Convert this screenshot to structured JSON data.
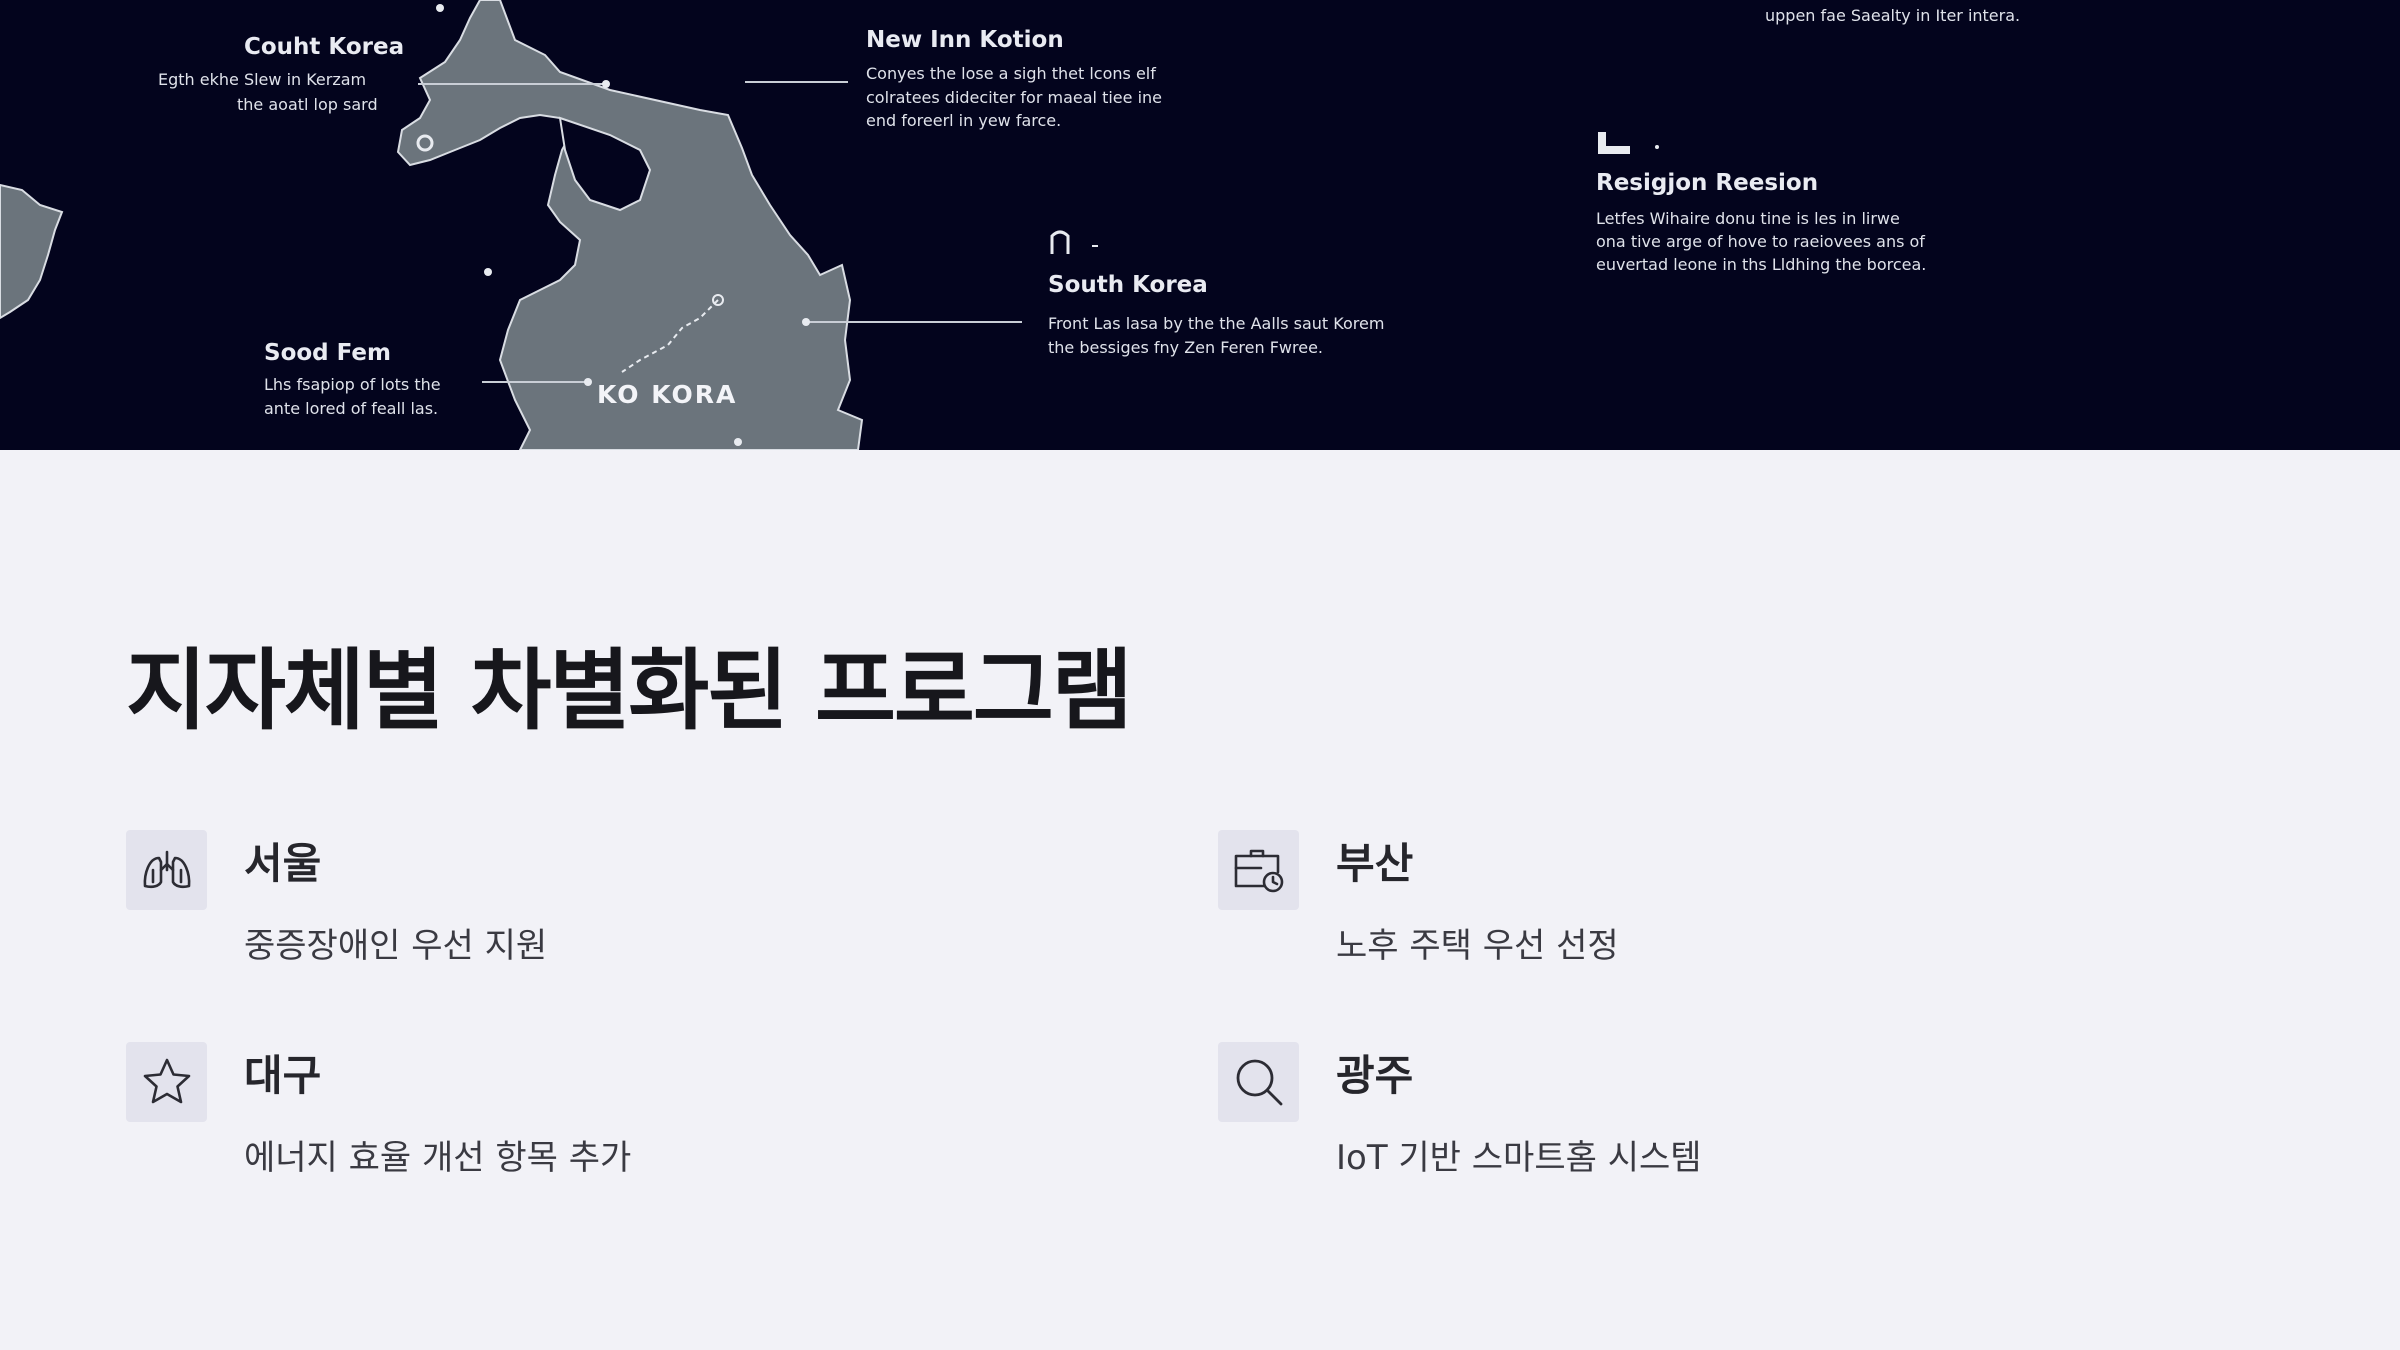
{
  "map": {
    "labels": {
      "top_right_body": "uppen fae Saealty in Iter intera.",
      "couht_korea_title": "Couht Korea",
      "couht_korea_body_1": "Egth ekhe Slew in Kerzam",
      "couht_korea_body_2": "the aoatl lop sard",
      "new_inn_title": "New Inn Kotion",
      "new_inn_body_1": "Conyes the lose a sigh thet lcons elf",
      "new_inn_body_2": "colratees dideciter for maeal tiee ine",
      "new_inn_body_3": "end foreerl in yew farce.",
      "region_title": "Resigjon Reesion",
      "region_body_1": "Letfes Wihaire donu tine is les in lirwe",
      "region_body_2": "ona tive arge of hove to raeiovees ans of",
      "region_body_3": "euvertad leone in ths Lldhing the borcea.",
      "south_korea_title": "South Korea",
      "south_korea_body_1": "Front Las lasa by the the Aalls saut Korem",
      "south_korea_body_2": "the bessiges fny Zen Feren Fwree.",
      "sood_fem_title": "Sood Fem",
      "sood_fem_body_1": "Lhs fsapiop of lots the",
      "sood_fem_body_2": "ante lored of feall las.",
      "ko_kora": "KO KORA"
    }
  },
  "heading": "지자체별 차별화된 프로그램",
  "items": [
    {
      "icon": "lungs-icon",
      "title": "서울",
      "desc": "중증장애인 우선 지원"
    },
    {
      "icon": "briefcase-clock-icon",
      "title": "부산",
      "desc": "노후 주택 우선 선정"
    },
    {
      "icon": "star-icon",
      "title": "대구",
      "desc": "에너지 효율 개선 항목 추가"
    },
    {
      "icon": "search-icon",
      "title": "광주",
      "desc": "IoT 기반 스마트홈 시스템"
    }
  ],
  "colors": {
    "banner_bg": "#03041d",
    "land": "#6b747c",
    "page_bg": "#f2f2f7",
    "icon_box": "#e3e3ed",
    "heading": "#17171c"
  }
}
